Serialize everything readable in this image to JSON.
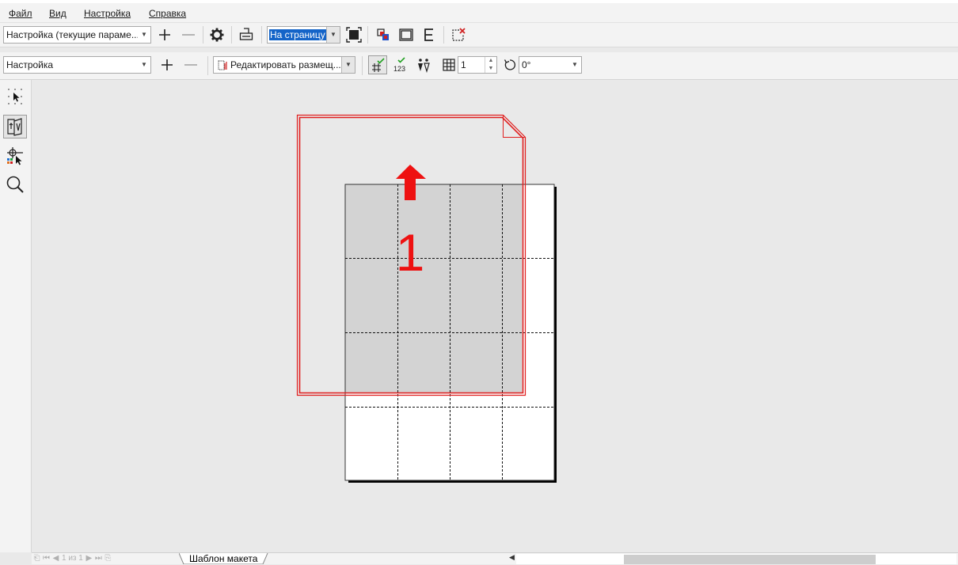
{
  "menu": {
    "items": [
      "Файл",
      "Вид",
      "Настройка",
      "Справка"
    ]
  },
  "toolbar1": {
    "preset_value": "Настройка (текущие параме...",
    "fit_value": "На страницу",
    "icons": [
      "plus-icon",
      "minus-icon",
      "gear-icon",
      "printer-icon",
      "fit-page-icon",
      "color-separation-icon",
      "page-frame-icon",
      "letter-e-icon",
      "close-preview-icon"
    ]
  },
  "toolbar2": {
    "template_value": "Настройка",
    "edit_layout_value": "Редактировать размещ...",
    "copies_value": "1",
    "rotation_value": "0°",
    "icons": [
      "plus-icon",
      "minus-icon",
      "layout-icon",
      "hash-check-icon",
      "number-check-icon",
      "figures-icon",
      "grid-icon",
      "rotate-icon"
    ]
  },
  "tools": [
    "pick-tool-icon",
    "imposition-tool-icon",
    "marks-tool-icon",
    "zoom-tool-icon"
  ],
  "canvas": {
    "page_number": "1",
    "sheet_columns": 4,
    "sheet_rows": 4,
    "colors": {
      "frame": "#e02020",
      "arrow": "#ee1111",
      "shaded_cells": "#d3d3d3",
      "sheet": "#ffffff"
    }
  },
  "bottom": {
    "page_counter": "1 из 1",
    "tab_label": "Шаблон макета"
  }
}
